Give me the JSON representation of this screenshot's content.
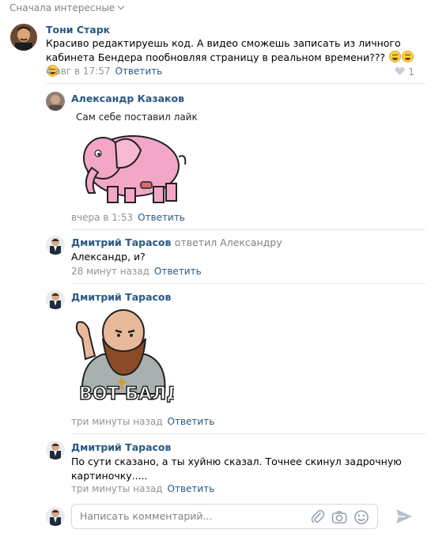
{
  "sort_label": "Сначала интересные",
  "comments": [
    {
      "author": "Тони Старк",
      "text_line1": "Красиво редактируешь код. А видео сможешь записать из личного",
      "text_line2": "кабинета Бендера пообновляя страницу в реальном времени???",
      "date": "4 авг в 17:57",
      "reply_label": "Ответить",
      "likes": "1"
    },
    {
      "author": "Александр Казаков",
      "sticker_caption": "Сам себе поставил лайк",
      "date": "вчера в 1:53",
      "reply_label": "Ответить"
    },
    {
      "author": "Дмитрий Тарасов",
      "replied_to": "ответил Александру",
      "text": "Александр, и?",
      "date": "28 минут назад",
      "reply_label": "Ответить"
    },
    {
      "author": "Дмитрий Тарасов",
      "sticker_caption": "ВОТ БАЛДА",
      "date": "три минуты назад",
      "reply_label": "Ответить"
    },
    {
      "author": "Дмитрий Тарасов",
      "text_line1": "По сути сказано, а ты хуйню сказал. Точнее скинул задрочную",
      "text_line2": "картиночку.....",
      "date": "три минуты назад",
      "reply_label": "Ответить"
    }
  ],
  "composer": {
    "placeholder": "Написать комментарий..."
  },
  "icons": [
    "chevron-down-icon",
    "heart-icon",
    "paperclip-icon",
    "camera-icon",
    "smiley-icon",
    "send-icon"
  ],
  "colors": {
    "link": "#2a5885",
    "meta": "#939393",
    "divider": "#e7e8ec"
  }
}
